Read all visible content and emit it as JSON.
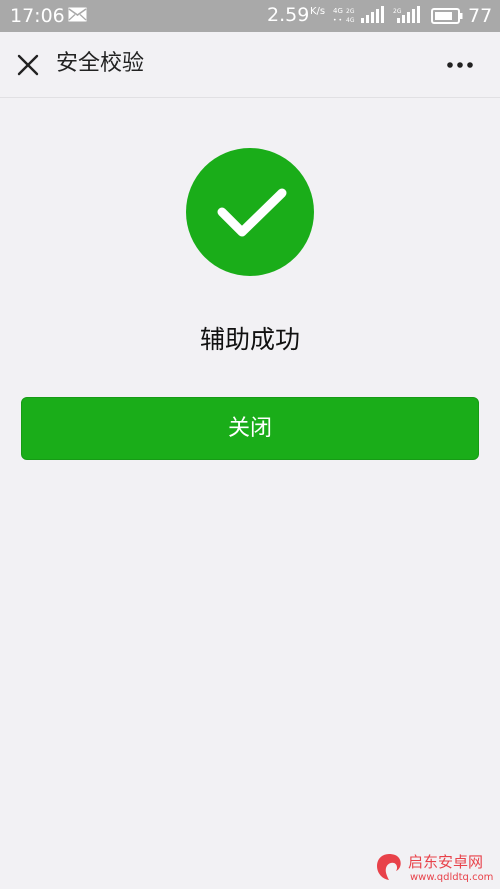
{
  "status_bar": {
    "time": "17:06",
    "net_speed": "2.59",
    "net_speed_unit": "K/s",
    "battery_level": "77",
    "icons": [
      "message-icon",
      "signal-4g-icon",
      "signal-2g-icon",
      "battery-icon"
    ]
  },
  "nav": {
    "title": "安全校验",
    "close_icon": "close-icon",
    "more_icon": "more-icon"
  },
  "result": {
    "icon": "success-check-icon",
    "message": "辅助成功",
    "accent_color": "#1aad19"
  },
  "actions": {
    "close_label": "关闭"
  },
  "watermark": {
    "name": "启东安卓网",
    "url": "www.qdldtq.com"
  }
}
